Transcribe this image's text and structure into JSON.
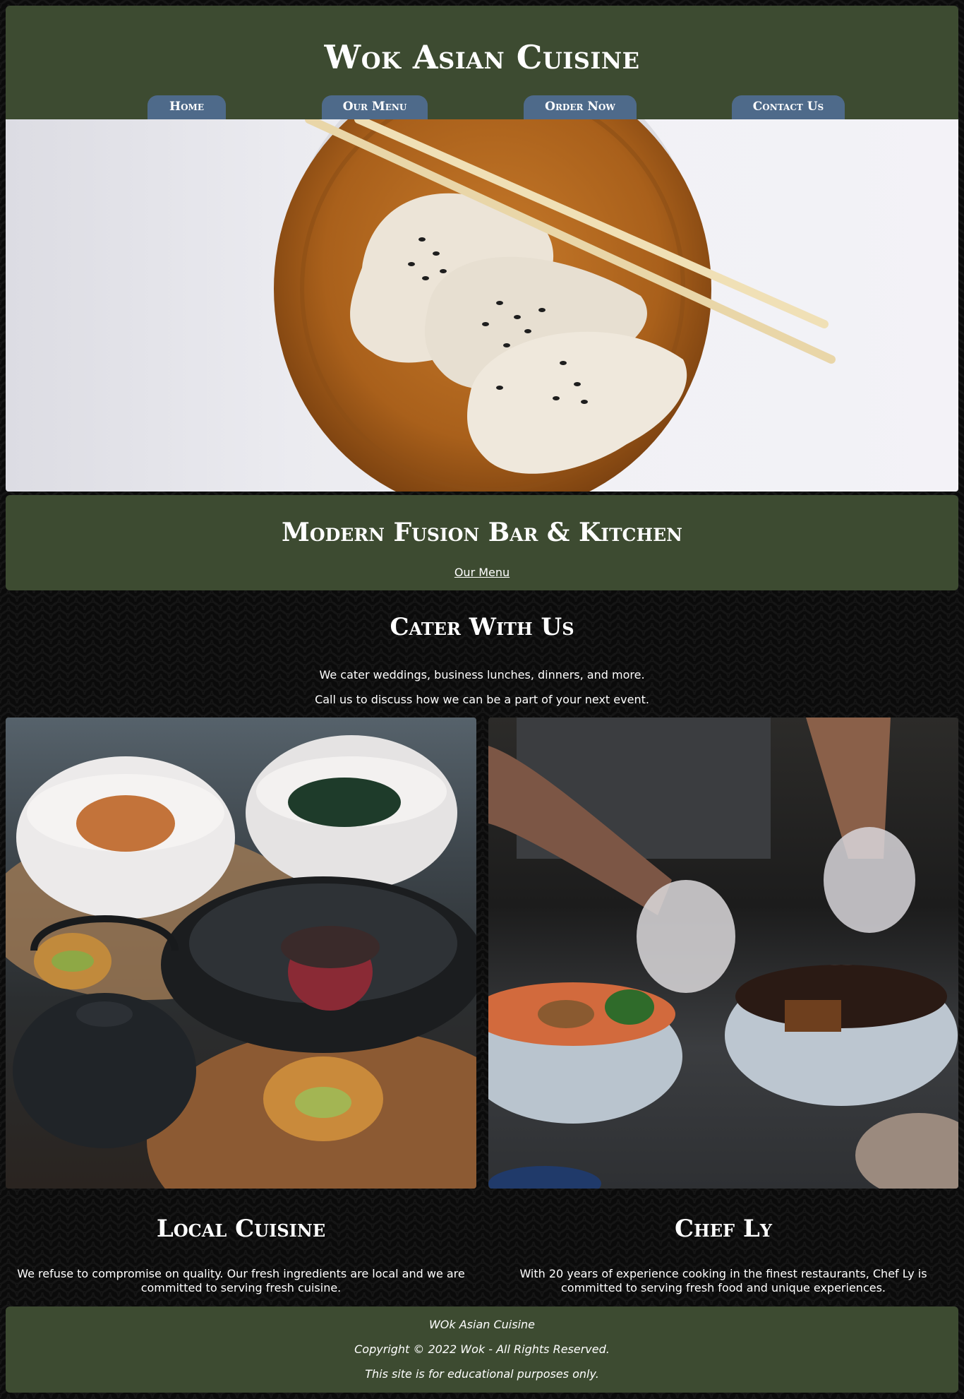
{
  "header": {
    "title": "Wok Asian Cuisine",
    "nav": [
      {
        "label": "Home"
      },
      {
        "label": "Our Menu"
      },
      {
        "label": "Order Now"
      },
      {
        "label": "Contact Us"
      }
    ]
  },
  "hero": {
    "image": "dumplings-on-wooden-plate-with-chopsticks"
  },
  "banner": {
    "title": "Modern Fusion Bar & Kitchen",
    "link_label": "Our Menu"
  },
  "cater": {
    "title": "Cater With Us",
    "line1": "We cater weddings, business lunches, dinners, and more.",
    "line2": "Call us to discuss how we can be a part of your next event."
  },
  "columns": [
    {
      "image": "rice-bowls-and-teapot",
      "title": "Local Cuisine",
      "text": "We refuse to compromise on quality. Our fresh ingredients are local and we are committed to serving fresh cuisine."
    },
    {
      "image": "chef-preparing-ramen",
      "title": "Chef Ly",
      "text": "With 20 years of experience cooking in the finest restaurants, Chef Ly is committed to serving fresh food and unique experiences."
    }
  ],
  "footer": {
    "line1": "WOk Asian Cuisine",
    "line2": "Copyright © 2022 Wok - All Rights Reserved.",
    "line3": "This site is for educational purposes only."
  },
  "colors": {
    "panel_green": "#3d4b31",
    "nav_blue": "#4e6a8a",
    "background": "#0b0b0b"
  }
}
